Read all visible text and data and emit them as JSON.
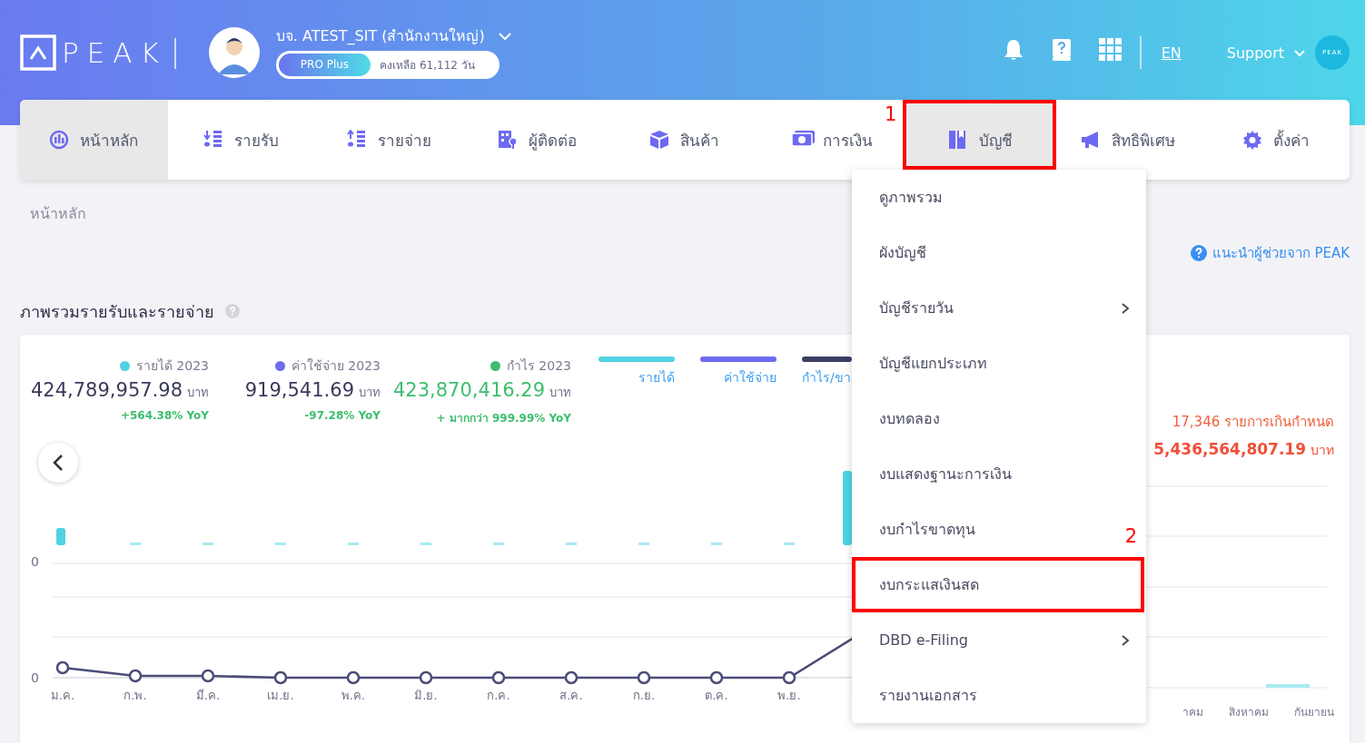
{
  "header": {
    "logo": "PEAK",
    "company": "บจ. ATEST_SIT (สำนักงานใหญ่)",
    "plan": "PRO Plus",
    "remaining": "คงเหลือ 61,112 วัน",
    "language": "EN",
    "support": "Support",
    "account_badge": "PEAK"
  },
  "tabs": [
    {
      "label": "หน้าหลัก",
      "selected": true
    },
    {
      "label": "รายรับ",
      "selected": false
    },
    {
      "label": "รายจ่าย",
      "selected": false
    },
    {
      "label": "ผู้ติดต่อ",
      "selected": false
    },
    {
      "label": "สินค้า",
      "selected": false
    },
    {
      "label": "การเงิน",
      "selected": false
    },
    {
      "label": "บัญชี",
      "selected": true,
      "annotation": "1"
    },
    {
      "label": "สิทธิพิเศษ",
      "selected": false
    },
    {
      "label": "ตั้งค่า",
      "selected": false
    }
  ],
  "menu": [
    {
      "label": "ดูภาพรวม",
      "submenu": false
    },
    {
      "label": "ผังบัญชี",
      "submenu": false
    },
    {
      "label": "บัญชีรายวัน",
      "submenu": true
    },
    {
      "label": "บัญชีแยกประเภท",
      "submenu": false
    },
    {
      "label": "งบทดลอง",
      "submenu": false
    },
    {
      "label": "งบแสดงฐานะการเงิน",
      "submenu": false
    },
    {
      "label": "งบกำไรขาดทุน",
      "submenu": false
    },
    {
      "label": "งบกระแสเงินสด",
      "submenu": false,
      "annotation": "2"
    },
    {
      "label": "DBD e-Filing",
      "submenu": true
    },
    {
      "label": "รายงานเอกสาร",
      "submenu": false
    }
  ],
  "breadcrumb": "หน้าหลัก",
  "help_link": "แนะนำผู้ช่วยจาก PEAK",
  "section_title": "ภาพรวมรายรับและรายจ่าย",
  "stats": [
    {
      "kind": "income",
      "label": "รายได้ 2023",
      "color": "#4fd3e2",
      "amount": "424,789,957.98",
      "unit": "บาท",
      "change": "+564.38% YoY"
    },
    {
      "kind": "expense",
      "label": "ค่าใช้จ่าย 2023",
      "color": "#6d6af2",
      "amount": "919,541.69",
      "unit": "บาท",
      "change": "-97.28% YoY"
    },
    {
      "kind": "profit",
      "label": "กำไร 2023",
      "color": "#3dbe6e",
      "amount": "423,870,416.29",
      "unit": "บาท",
      "change": "+ มากกว่า 999.99% YoY"
    }
  ],
  "legend": [
    {
      "label": "รายได้",
      "color": "#4fd3e2"
    },
    {
      "label": "ค่าใช้จ่าย",
      "color": "#6d6af2"
    },
    {
      "label": "กำไร/ขา",
      "color": "#3b3d63"
    }
  ],
  "chart": {
    "axis_labels": [
      "0",
      "0"
    ],
    "months": [
      "ม.ค.",
      "ก.พ.",
      "มี.ค.",
      "เม.ย.",
      "พ.ค.",
      "มิ.ย.",
      "ก.ค.",
      "ส.ค.",
      "ก.ย.",
      "ต.ค.",
      "พ.ย."
    ]
  },
  "overdue": {
    "count": "17,346 รายการเกินกำหนด",
    "amount": "5,436,564,807.19",
    "unit": "บาท",
    "months": [
      "าคม",
      "สิงหาคม",
      "กันยายน"
    ]
  }
}
